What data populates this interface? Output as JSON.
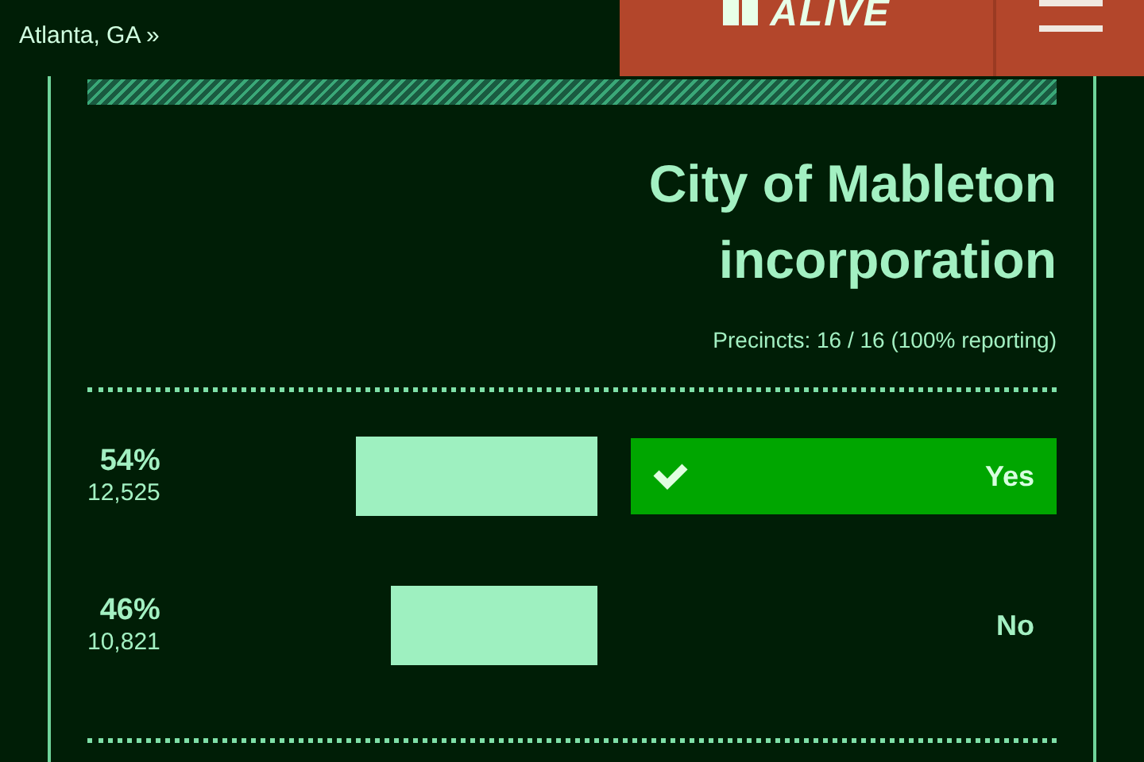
{
  "header": {
    "logo": "ALIVE",
    "location_link": "Atlanta, GA »"
  },
  "race": {
    "title": "City of Mableton incorporation",
    "precincts": "Precincts: 16 / 16 (100% reporting)",
    "candidates": [
      {
        "name": "Yes",
        "winner": true,
        "percent": "54%",
        "votes": "12,525"
      },
      {
        "name": "No",
        "winner": false,
        "percent": "46%",
        "votes": "10,821"
      }
    ]
  }
}
